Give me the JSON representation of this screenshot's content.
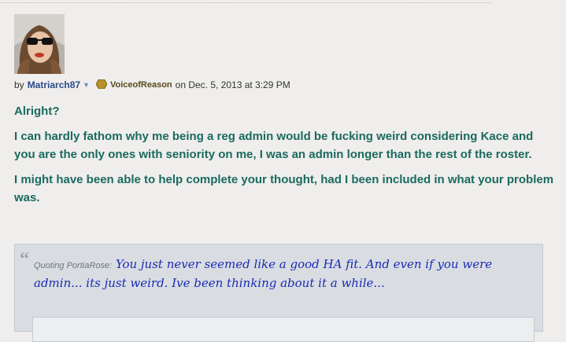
{
  "post": {
    "by_label": "by",
    "author": "Matriarch87",
    "rank": "VoiceofReason",
    "date_text": "on Dec. 5, 2013 at 3:29 PM",
    "paragraphs": [
      "Alright?",
      "I can hardly fathom why me being a reg admin would be fucking weird considering Kace and you are the only ones with seniority on me, I was an admin longer than the rest of the roster.",
      "I might have been able to help complete your thought, had I been included in what your problem was."
    ]
  },
  "quote": {
    "label": "Quoting PortiaRose:",
    "text": "You just never seemed like a good HA fit. And even if you were admin... its just weird. Ive been thinking about it a while..."
  },
  "colors": {
    "post_text": "#1b6a5f",
    "author_link": "#2a4a8a",
    "quote_text": "#1a2bb3",
    "quote_bg": "#d9dde2"
  },
  "icons": {
    "author_menu": "chevron-down-icon",
    "rank_badge": "hexagon-badge-icon",
    "quote_mark": "quote-mark-icon"
  }
}
